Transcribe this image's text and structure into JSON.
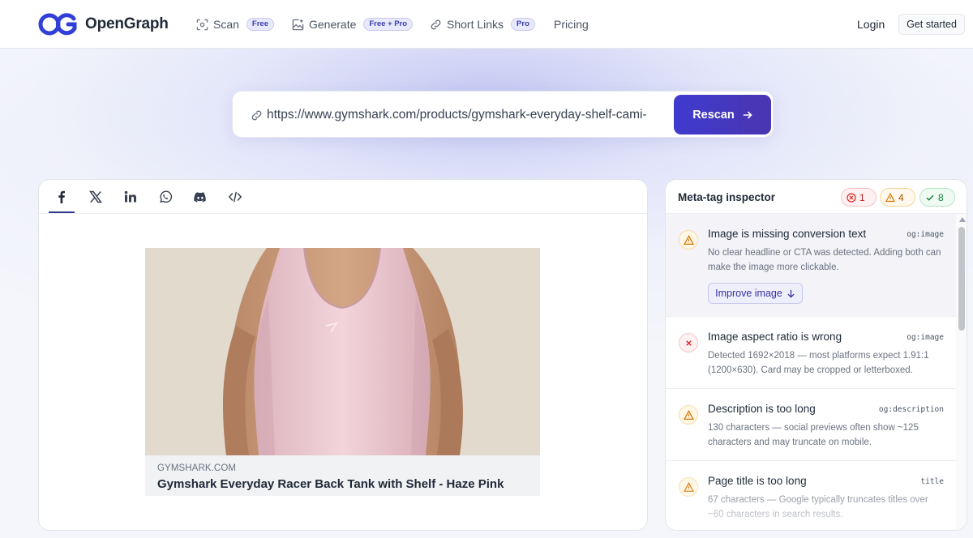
{
  "app": {
    "name": "OpenGraph"
  },
  "nav": [
    {
      "label": "Scan",
      "badge": "Free",
      "icon": "scan-icon"
    },
    {
      "label": "Generate",
      "badge": "Free + Pro",
      "icon": "image-sparkle-icon"
    },
    {
      "label": "Short Links",
      "badge": "Pro",
      "icon": "link-icon"
    },
    {
      "label": "Pricing"
    }
  ],
  "auth": {
    "login": "Login",
    "get_started": "Get started"
  },
  "url_bar": {
    "value": "https://www.gymshark.com/products/gymshark-everyday-shelf-cami-",
    "button": "Rescan"
  },
  "preview": {
    "tabs": [
      {
        "icon": "facebook-icon",
        "active": true
      },
      {
        "icon": "x-icon"
      },
      {
        "icon": "linkedin-icon"
      },
      {
        "icon": "whatsapp-icon"
      },
      {
        "icon": "discord-icon"
      },
      {
        "icon": "code-icon"
      }
    ],
    "domain": "GYMSHARK.COM",
    "title": "Gymshark Everyday Racer Back Tank with Shelf - Haze Pink"
  },
  "inspector": {
    "title": "Meta-tag inspector",
    "counts": {
      "errors": "1",
      "warnings": "4",
      "passed": "8"
    },
    "issues": [
      {
        "severity": "warning",
        "title": "Image is missing conversion text",
        "tag": "og:image",
        "desc": "No clear headline or CTA was detected. Adding both can make the image more clickable.",
        "action": "Improve image"
      },
      {
        "severity": "error",
        "title": "Image aspect ratio is wrong",
        "tag": "og:image",
        "desc": "Detected 1692×2018 — most platforms expect 1.91:1 (1200×630). Card may be cropped or letterboxed."
      },
      {
        "severity": "warning",
        "title": "Description is too long",
        "tag": "og:description",
        "desc": "130 characters — social previews often show ~125 characters and may truncate on mobile."
      },
      {
        "severity": "warning",
        "title": "Page title is too long",
        "tag": "title",
        "desc": "67 characters — Google typically truncates titles over ~60 characters in search results."
      }
    ]
  },
  "colors": {
    "accent": "#3f3bcf",
    "error": "#dc2626",
    "warning": "#d97706",
    "success": "#15803d"
  }
}
